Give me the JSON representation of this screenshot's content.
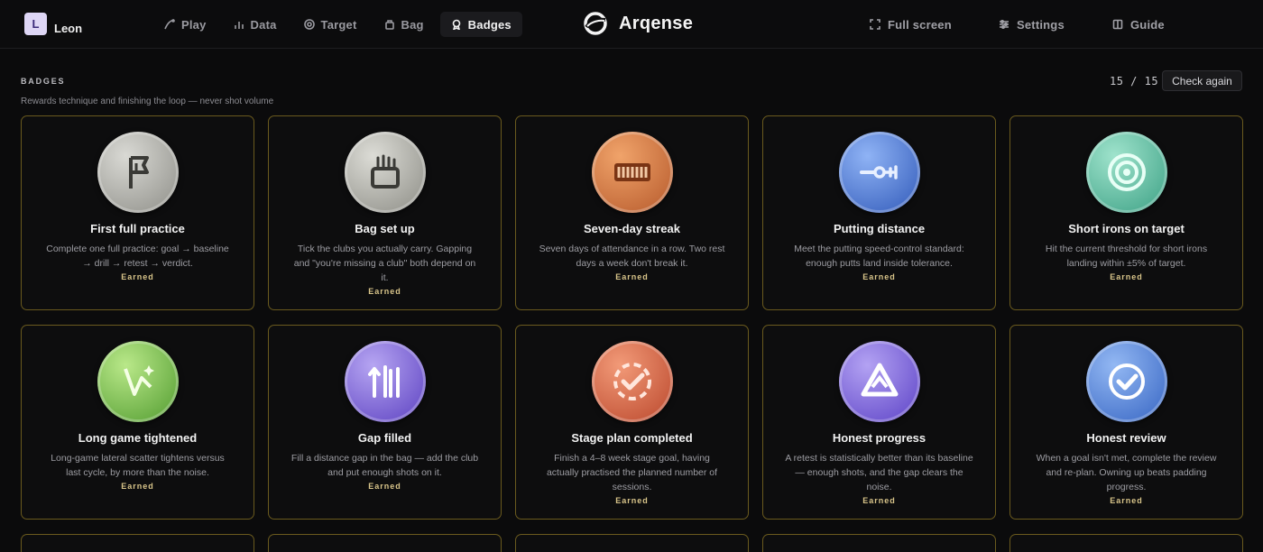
{
  "user": {
    "initial": "L",
    "name": "Leon"
  },
  "nav": [
    {
      "label": "Play",
      "icon": "play-icon",
      "active": false
    },
    {
      "label": "Data",
      "icon": "chart-icon",
      "active": false
    },
    {
      "label": "Target",
      "icon": "target-icon",
      "active": false
    },
    {
      "label": "Bag",
      "icon": "bag-icon",
      "active": false
    },
    {
      "label": "Badges",
      "icon": "badge-icon",
      "active": true
    }
  ],
  "brand": {
    "name": "Arqense"
  },
  "right_nav": {
    "fullscreen": "Full screen",
    "settings": "Settings",
    "guide": "Guide"
  },
  "section": {
    "title": "BADGES",
    "subtitle": "Rewards technique and finishing the loop — never shot volume",
    "earned": "15",
    "total": "15",
    "counter": "15 / 15",
    "check_label": "Check again"
  },
  "badges": [
    {
      "title": "First full practice",
      "desc": "Complete one full practice: goal → baseline → drill → retest → verdict.",
      "status": "Earned",
      "icon": "flag-icon",
      "colors": [
        "#d9d9d4",
        "#8d8d87"
      ]
    },
    {
      "title": "Bag set up",
      "desc": "Tick the clubs you actually carry. Gapping and \"you're missing a club\" both depend on it.",
      "status": "Earned",
      "icon": "golf-bag-icon",
      "colors": [
        "#dcdcd6",
        "#8b8b84"
      ]
    },
    {
      "title": "Seven-day streak",
      "desc": "Seven days of attendance in a row. Two rest days a week don't break it.",
      "status": "Earned",
      "icon": "calendar-streak-icon",
      "colors": [
        "#f0a36a",
        "#b5582a"
      ]
    },
    {
      "title": "Putting distance",
      "desc": "Meet the putting speed-control standard: enough putts land inside tolerance.",
      "status": "Earned",
      "icon": "putter-icon",
      "colors": [
        "#8fb3f5",
        "#2f58b8"
      ]
    },
    {
      "title": "Short irons on target",
      "desc": "Hit the current threshold for short irons landing within ±5% of target.",
      "status": "Earned",
      "icon": "bullseye-icon",
      "colors": [
        "#9fe3cc",
        "#3a9f83"
      ]
    },
    {
      "title": "Long game tightened",
      "desc": "Long-game lateral scatter tightens versus last cycle, by more than the noise.",
      "status": "Earned",
      "icon": "scatter-icon",
      "colors": [
        "#b9e889",
        "#4f9a2d"
      ]
    },
    {
      "title": "Gap filled",
      "desc": "Fill a distance gap in the bag — add the club and put enough shots on it.",
      "status": "Earned",
      "icon": "gap-arrows-icon",
      "colors": [
        "#b6a5f2",
        "#5a3fc0"
      ]
    },
    {
      "title": "Stage plan completed",
      "desc": "Finish a 4–8 week stage goal, having actually practised the planned number of sessions.",
      "status": "Earned",
      "icon": "check-circle-icon",
      "colors": [
        "#f29a78",
        "#b9452a"
      ]
    },
    {
      "title": "Honest progress",
      "desc": "A retest is statistically better than its baseline — enough shots, and the gap clears the noise.",
      "status": "Earned",
      "icon": "triangle-icon",
      "colors": [
        "#b3a2f3",
        "#5a40c5"
      ]
    },
    {
      "title": "Honest review",
      "desc": "When a goal isn't met, complete the review and re-plan. Owning up beats padding progress.",
      "status": "Earned",
      "icon": "review-check-icon",
      "colors": [
        "#93b8f3",
        "#3463c2"
      ]
    }
  ]
}
